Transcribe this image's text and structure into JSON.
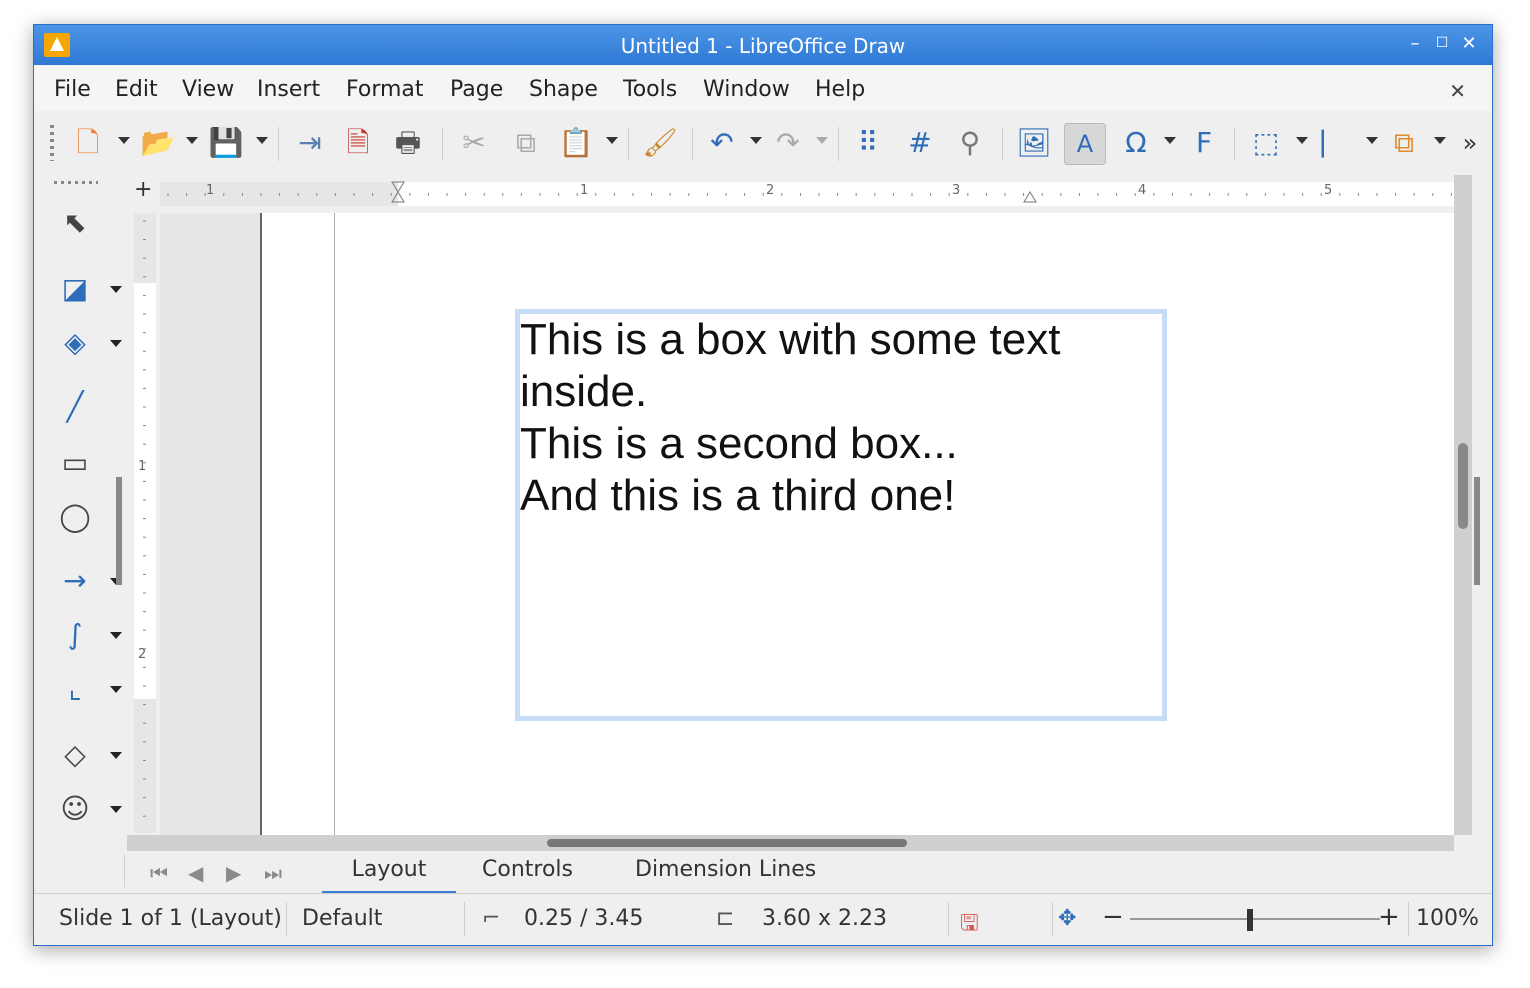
{
  "window": {
    "title": "Untitled 1 - LibreOffice Draw"
  },
  "menu": [
    "File",
    "Edit",
    "View",
    "Insert",
    "Format",
    "Page",
    "Shape",
    "Tools",
    "Window",
    "Help"
  ],
  "document": {
    "lines": [
      "This is a box with some text",
      "inside.",
      "This is a second box...",
      "And this is a third one!"
    ]
  },
  "hruler_labels": [
    "1",
    "1",
    "2",
    "3",
    "4",
    "5"
  ],
  "vruler_labels": [
    "1",
    "2"
  ],
  "tabs": [
    "Layout",
    "Controls",
    "Dimension Lines"
  ],
  "status": {
    "slide": "Slide 1 of 1 (Layout)",
    "layout": "Default",
    "position": "0.25 / 3.45",
    "size": "3.60 x 2.23",
    "zoom": "100%"
  },
  "colors": {
    "accent": "#3a7bd5",
    "titlebar": "#3b86df",
    "textbox_border": "#c7dcf5"
  }
}
